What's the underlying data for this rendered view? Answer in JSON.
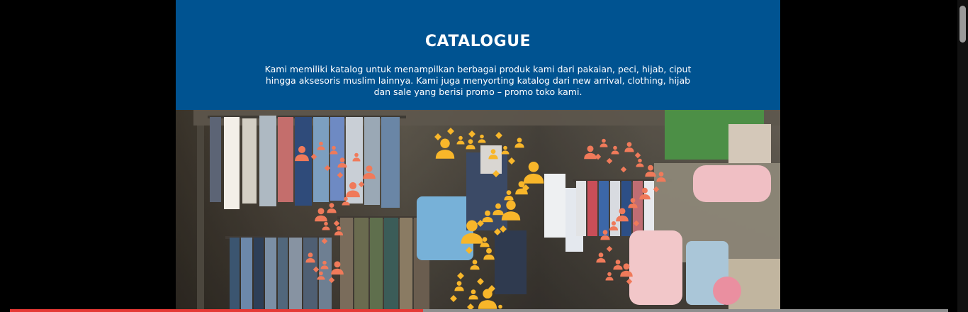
{
  "catalogue": {
    "title": "CATALOGUE",
    "description": "Kami memiliki katalog untuk menampilkan berbagai produk kami dari pakaian, peci, hijab, ciput hingga aksesoris muslim lainnya. Kami juga menyorting katalog dari new arrival, clothing, hijab dan sale yang berisi promo – promo toko kami."
  },
  "colors": {
    "header_bg": "#005391",
    "icon_coral": "#f07a5a",
    "icon_amber": "#f8b62a",
    "progress_red": "#e53935"
  },
  "icons": {
    "person": "person-icon",
    "diamond": "diamond-icon"
  },
  "video_progress": {
    "fraction": 0.44
  }
}
